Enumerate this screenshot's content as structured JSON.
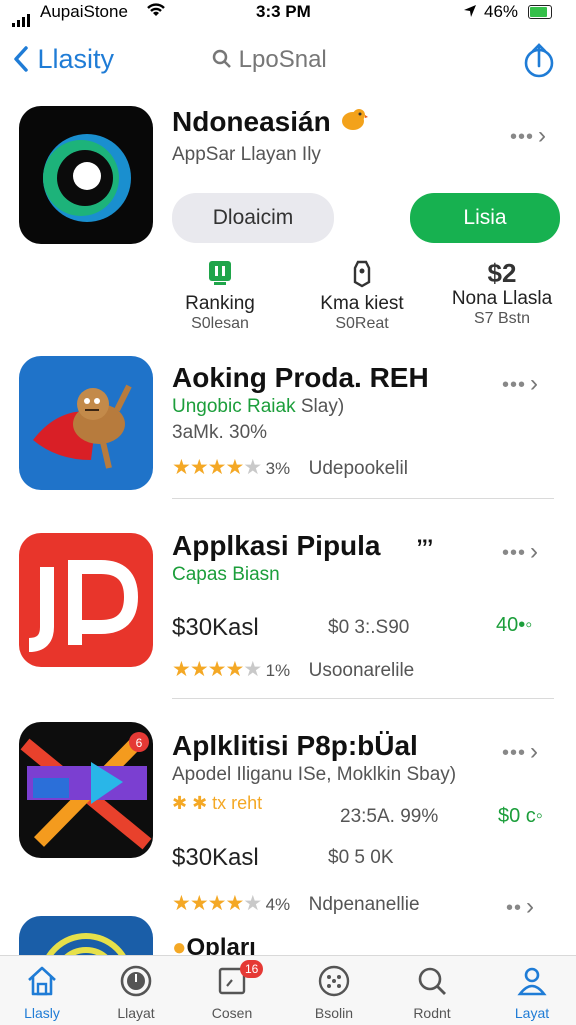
{
  "status": {
    "carrier": "AupaiStone",
    "time": "3:3 PM",
    "battery": "46%"
  },
  "nav": {
    "back_label": "Llasity",
    "search_label": "LpoSnal"
  },
  "featured": {
    "title": "Ndoneasián",
    "subtitle": "AppSar Llayan Ily",
    "left_button": "Dloaicim",
    "right_button": "Lisia",
    "stats": [
      {
        "value": "",
        "label": "Ranking",
        "count": "S0lesan"
      },
      {
        "value": "",
        "label": "Kma kiest",
        "count": "S0Reat"
      },
      {
        "value": "$2",
        "label": "Nona Llasla",
        "count": "S7 Bstn"
      }
    ]
  },
  "apps": [
    {
      "title": "Aoking Proda. REH",
      "subtitle": "Ungobic Raiak",
      "subtitle_extra": "Slay)",
      "meta": "3aMk. 30%",
      "rating_pct": "3%",
      "stars": 4,
      "publisher": "Udepookelil"
    },
    {
      "title": "Applkasi Pipula",
      "title_mark": "’’’",
      "subtitle": "Capas Biasn",
      "price": "$30Kasl",
      "price2": "$0 3:.S90",
      "right_value": "40•◦",
      "rating_pct": "1%",
      "stars": 4,
      "publisher": "Usoonarelile"
    },
    {
      "title": "Aplklitisi P8p:bÜal",
      "subtitle": "Apodel Iliganu ISe, Moklkin Sbay)",
      "tag": "✱ ✱ tx reht",
      "meta": "23:5A. 99%",
      "right_value": "$0 c◦",
      "price": "$30Kasl",
      "price2": "$0 5 0K",
      "rating_pct": "4%",
      "stars": 4,
      "publisher": "Ndpenanellie"
    },
    {
      "title": "Opları"
    }
  ],
  "tabs": [
    {
      "label": "Llasly"
    },
    {
      "label": "Llayat"
    },
    {
      "label": "Cosen",
      "badge": "16"
    },
    {
      "label": "Bsolin"
    },
    {
      "label": "Rodnt"
    },
    {
      "label": "Layat"
    }
  ],
  "colors": {
    "accent": "#1f7cd6",
    "green": "#1c9e3b",
    "star": "#f4a825"
  }
}
